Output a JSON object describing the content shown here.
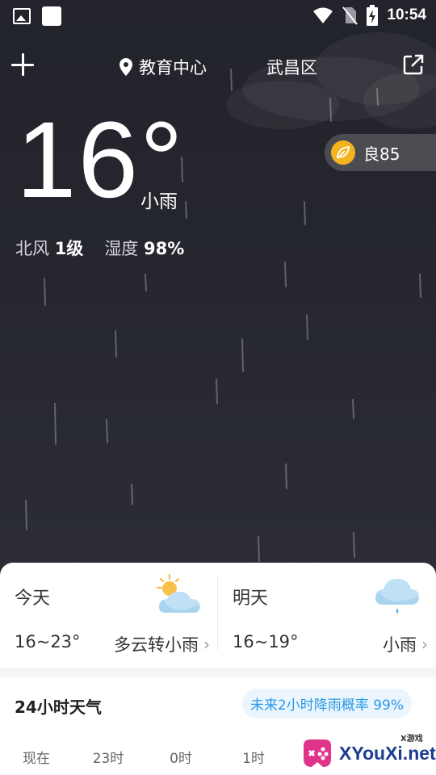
{
  "status_bar": {
    "time": "10:54",
    "icons": [
      "image-icon",
      "app-square-icon",
      "wifi-icon",
      "no-sim-icon",
      "battery-charging-icon"
    ]
  },
  "header": {
    "location": "教育中心",
    "district": "武昌区",
    "add_icon": "plus-icon",
    "share_icon": "share-icon"
  },
  "current": {
    "temperature": "16°",
    "condition": "小雨",
    "wind_label": "北风",
    "wind_value": "1级",
    "humidity_label": "湿度",
    "humidity_value": "98%",
    "aqi_text": "良85",
    "aqi_color": "#f3b321"
  },
  "forecast": {
    "today": {
      "name": "今天",
      "range": "16~23°",
      "condition": "多云转小雨",
      "icon": "partly-cloudy-icon"
    },
    "tomorrow": {
      "name": "明天",
      "range": "16~19°",
      "condition": "小雨",
      "icon": "light-rain-icon"
    }
  },
  "hourly": {
    "title": "24小时天气",
    "rain_probability": "未来2小时降雨概率 99%",
    "hours": [
      "现在",
      "23时",
      "0时",
      "1时"
    ]
  },
  "watermark": {
    "text": "XYouXi.net",
    "small": "X游戏"
  },
  "colors": {
    "background": "#25262e",
    "card": "#ffffff",
    "accent_blue": "#2a9ae6"
  }
}
